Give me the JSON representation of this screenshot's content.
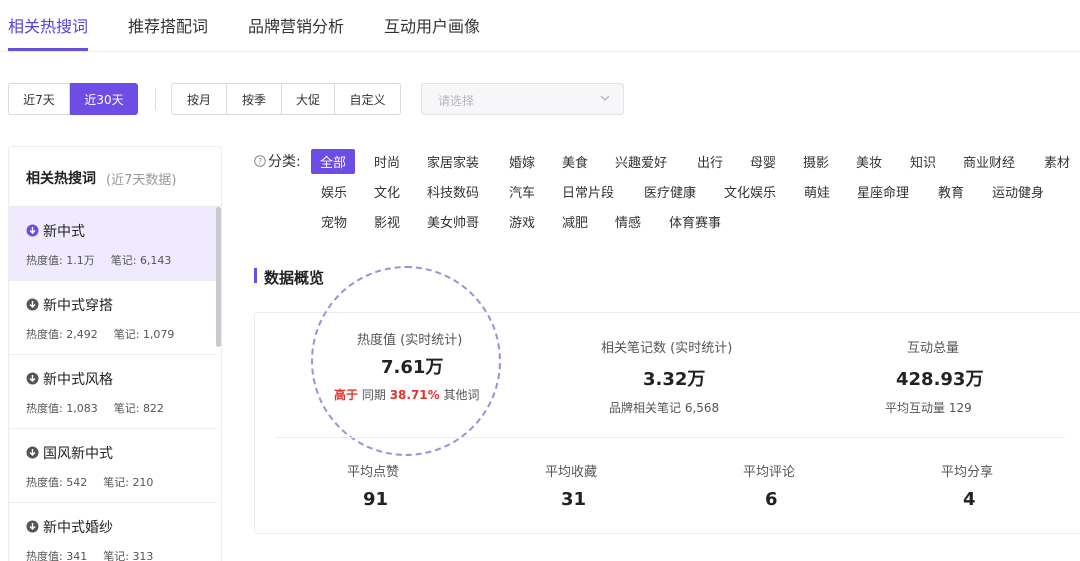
{
  "top_tabs": [
    "相关热搜词",
    "推荐搭配词",
    "品牌营销分析",
    "互动用户画像"
  ],
  "toolbar": {
    "range_buttons": [
      "近7天",
      "近30天"
    ],
    "period_buttons": [
      "按月",
      "按季",
      "大促",
      "自定义"
    ],
    "select_placeholder": "请选择",
    "active_range": "近30天"
  },
  "left_panel": {
    "title": "相关热搜词",
    "subtitle": "(近7天数据)",
    "heat_label": "热度值:",
    "note_label": "笔记:",
    "items": [
      {
        "name": "新中式",
        "heat": "1.1万",
        "notes": "6,143"
      },
      {
        "name": "新中式穿搭",
        "heat": "2,492",
        "notes": "1,079"
      },
      {
        "name": "新中式风格",
        "heat": "1,083",
        "notes": "822"
      },
      {
        "name": "国风新中式",
        "heat": "542",
        "notes": "210"
      },
      {
        "name": "新中式婚纱",
        "heat": "341",
        "notes": "313"
      }
    ]
  },
  "categories": {
    "label": "分类:",
    "row1": [
      "全部",
      "时尚",
      "家居家装",
      "婚嫁",
      "美食",
      "兴趣爱好",
      "出行",
      "母婴",
      "摄影",
      "美妆",
      "知识",
      "商业财经",
      "素材"
    ],
    "row2": [
      "娱乐",
      "文化",
      "科技数码",
      "汽车",
      "日常片段",
      "医疗健康",
      "文化娱乐",
      "萌娃",
      "星座命理",
      "教育",
      "运动健身"
    ],
    "row3": [
      "宠物",
      "影视",
      "美女帅哥",
      "游戏",
      "减肥",
      "情感",
      "体育赛事"
    ]
  },
  "overview": {
    "title": "数据概览",
    "heat": {
      "label": "热度值 (实时统计)",
      "value": "7.61万",
      "compare_prefix": "高于",
      "compare_mid": "同期",
      "compare_pct": "38.71%",
      "compare_suffix": "其他词"
    },
    "notes": {
      "label": "相关笔记数 (实时统计)",
      "value": "3.32万",
      "sub": "品牌相关笔记 6,568"
    },
    "interaction": {
      "label": "互动总量",
      "value": "428.93万",
      "sub": "平均互动量 129"
    },
    "averages": [
      {
        "label": "平均点赞",
        "value": "91"
      },
      {
        "label": "平均收藏",
        "value": "31"
      },
      {
        "label": "平均评论",
        "value": "6"
      },
      {
        "label": "平均分享",
        "value": "4"
      }
    ]
  },
  "colors": {
    "accent": "#6e4ce6",
    "highlight_red": "#e5342f",
    "selected_bg": "#efeafd"
  }
}
